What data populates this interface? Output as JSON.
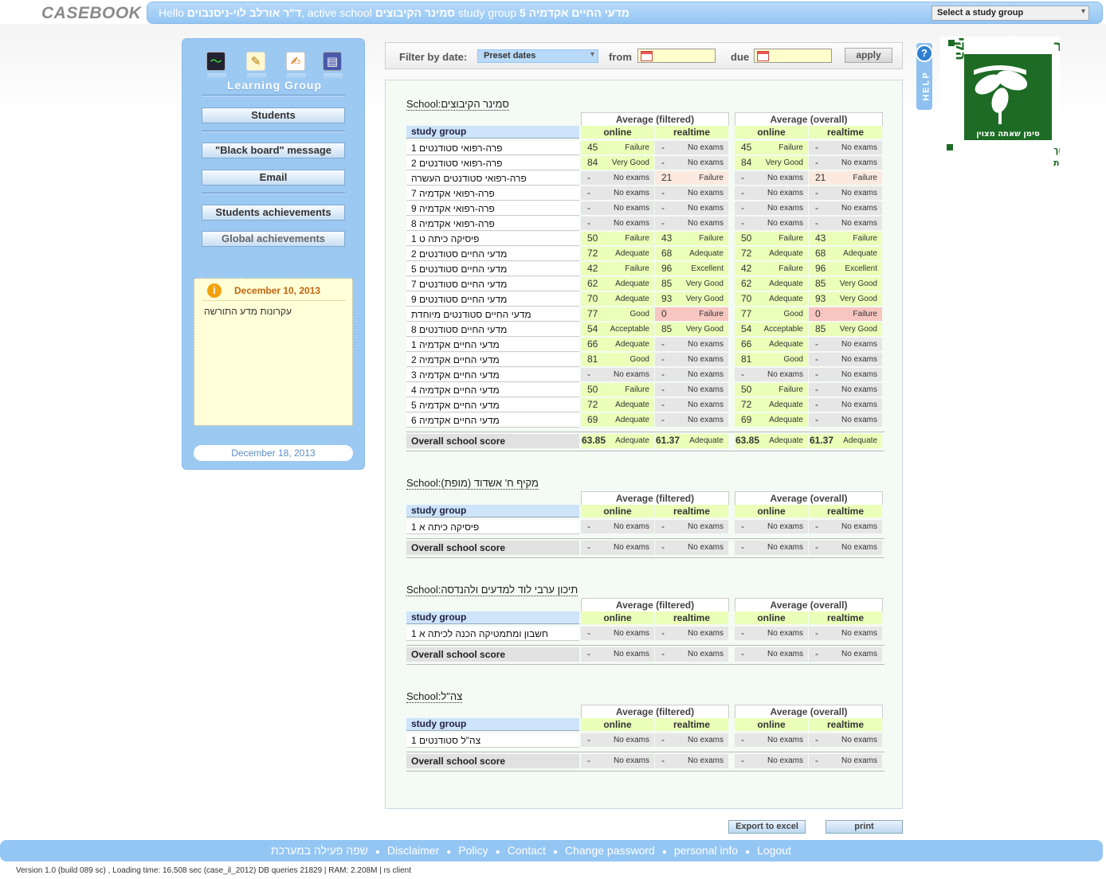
{
  "header": {
    "logo": "CASEBOOK",
    "hello_prefix": "Hello",
    "user": "ד\"ר אורלב לוי-ניסנבוים",
    "active_school_label": ", active school",
    "active_school": "סמינר הקיבוצים",
    "study_group_label": "study group",
    "study_group": "מדעי החיים אקדמיה 5",
    "select_placeholder": "Select a study group"
  },
  "sidebar": {
    "section_label": "Learning Group",
    "icons": [
      "activity-icon",
      "edit-icon",
      "notes-icon",
      "book-icon"
    ],
    "buttons": [
      "Students",
      "\"Black board\" message",
      "Email",
      "Students achievements",
      "Global achievements"
    ],
    "note": {
      "date": "December 10, 2013",
      "text": "עקרונות מדע התורשה"
    },
    "bottom_date": "December 18, 2013"
  },
  "filter": {
    "label": "Filter by date:",
    "preset": "Preset dates",
    "from_label": "from",
    "due_label": "due",
    "from_value": "",
    "due_value": "",
    "apply_label": "apply"
  },
  "help": {
    "label": "HELP",
    "icon": "question-icon"
  },
  "table_labels": {
    "school_prefix": "School:",
    "avg_filtered": "Average (filtered)",
    "avg_overall": "Average (overall)",
    "study_group": "study group",
    "online": "online",
    "realtime": "realtime",
    "overall_score": "Overall school score",
    "no_exams": "No exams",
    "dash": "-"
  },
  "schools": [
    {
      "name": "סמינר הקיבוצים",
      "groups": [
        {
          "name": "פרה-רפואי סטודנטים 1",
          "cells": [
            [
              "45",
              "Failure",
              "g"
            ],
            [
              "-",
              "No exams",
              "x"
            ],
            [
              "45",
              "Failure",
              "g"
            ],
            [
              "-",
              "No exams",
              "x"
            ]
          ]
        },
        {
          "name": "פרה-רפואי סטודנטים 2",
          "cells": [
            [
              "84",
              "Very Good",
              "g"
            ],
            [
              "-",
              "No exams",
              "x"
            ],
            [
              "84",
              "Very Good",
              "g"
            ],
            [
              "-",
              "No exams",
              "x"
            ]
          ]
        },
        {
          "name": "פרה-רפואי סטודנטים העשרה",
          "cells": [
            [
              "-",
              "No exams",
              "x"
            ],
            [
              "21",
              "Failure",
              "f"
            ],
            [
              "-",
              "No exams",
              "x"
            ],
            [
              "21",
              "Failure",
              "f"
            ]
          ]
        },
        {
          "name": "פרה-רפואי אקדמיה 7",
          "cells": [
            [
              "-",
              "No exams",
              "x"
            ],
            [
              "-",
              "No exams",
              "x"
            ],
            [
              "-",
              "No exams",
              "x"
            ],
            [
              "-",
              "No exams",
              "x"
            ]
          ]
        },
        {
          "name": "פרה-רפואי אקדמיה 9",
          "cells": [
            [
              "-",
              "No exams",
              "x"
            ],
            [
              "-",
              "No exams",
              "x"
            ],
            [
              "-",
              "No exams",
              "x"
            ],
            [
              "-",
              "No exams",
              "x"
            ]
          ]
        },
        {
          "name": "פרה-רפואי אקדמיה 8",
          "cells": [
            [
              "-",
              "No exams",
              "x"
            ],
            [
              "-",
              "No exams",
              "x"
            ],
            [
              "-",
              "No exams",
              "x"
            ],
            [
              "-",
              "No exams",
              "x"
            ]
          ]
        },
        {
          "name": "פיסיקה כיתה ט 1",
          "cells": [
            [
              "50",
              "Failure",
              "g"
            ],
            [
              "43",
              "Failure",
              "g"
            ],
            [
              "50",
              "Failure",
              "g"
            ],
            [
              "43",
              "Failure",
              "g"
            ]
          ]
        },
        {
          "name": "מדעי החיים סטודנטים 2",
          "cells": [
            [
              "72",
              "Adequate",
              "g"
            ],
            [
              "68",
              "Adequate",
              "g"
            ],
            [
              "72",
              "Adequate",
              "g"
            ],
            [
              "68",
              "Adequate",
              "g"
            ]
          ]
        },
        {
          "name": "מדעי החיים סטודנטים 5",
          "cells": [
            [
              "42",
              "Failure",
              "g"
            ],
            [
              "96",
              "Excellent",
              "g"
            ],
            [
              "42",
              "Failure",
              "g"
            ],
            [
              "96",
              "Excellent",
              "g"
            ]
          ]
        },
        {
          "name": "מדעי החיים סטודנטים 7",
          "cells": [
            [
              "62",
              "Adequate",
              "g"
            ],
            [
              "85",
              "Very Good",
              "g"
            ],
            [
              "62",
              "Adequate",
              "g"
            ],
            [
              "85",
              "Very Good",
              "g"
            ]
          ]
        },
        {
          "name": "מדעי החיים סטודנטים 9",
          "cells": [
            [
              "70",
              "Adequate",
              "g"
            ],
            [
              "93",
              "Very Good",
              "g"
            ],
            [
              "70",
              "Adequate",
              "g"
            ],
            [
              "93",
              "Very Good",
              "g"
            ]
          ]
        },
        {
          "name": "מדעי החיים סטודנטים מיוחדת",
          "cells": [
            [
              "77",
              "Good",
              "g"
            ],
            [
              "0",
              "Failure",
              "r"
            ],
            [
              "77",
              "Good",
              "g"
            ],
            [
              "0",
              "Failure",
              "r"
            ]
          ]
        },
        {
          "name": "מדעי החיים סטודנטים 8",
          "cells": [
            [
              "54",
              "Acceptable",
              "g"
            ],
            [
              "85",
              "Very Good",
              "g"
            ],
            [
              "54",
              "Acceptable",
              "g"
            ],
            [
              "85",
              "Very Good",
              "g"
            ]
          ]
        },
        {
          "name": "מדעי החיים אקדמיה 1",
          "cells": [
            [
              "66",
              "Adequate",
              "g"
            ],
            [
              "-",
              "No exams",
              "x"
            ],
            [
              "66",
              "Adequate",
              "g"
            ],
            [
              "-",
              "No exams",
              "x"
            ]
          ]
        },
        {
          "name": "מדעי החיים אקדמיה 2",
          "cells": [
            [
              "81",
              "Good",
              "g"
            ],
            [
              "-",
              "No exams",
              "x"
            ],
            [
              "81",
              "Good",
              "g"
            ],
            [
              "-",
              "No exams",
              "x"
            ]
          ]
        },
        {
          "name": "מדעי החיים אקדמיה 3",
          "cells": [
            [
              "-",
              "No exams",
              "x"
            ],
            [
              "-",
              "No exams",
              "x"
            ],
            [
              "-",
              "No exams",
              "x"
            ],
            [
              "-",
              "No exams",
              "x"
            ]
          ]
        },
        {
          "name": "מדעי החיים אקדמיה 4",
          "cells": [
            [
              "50",
              "Failure",
              "g"
            ],
            [
              "-",
              "No exams",
              "x"
            ],
            [
              "50",
              "Failure",
              "g"
            ],
            [
              "-",
              "No exams",
              "x"
            ]
          ]
        },
        {
          "name": "מדעי החיים אקדמיה 5",
          "cells": [
            [
              "72",
              "Adequate",
              "g"
            ],
            [
              "-",
              "No exams",
              "x"
            ],
            [
              "72",
              "Adequate",
              "g"
            ],
            [
              "-",
              "No exams",
              "x"
            ]
          ]
        },
        {
          "name": "מדעי החיים אקדמיה 6",
          "cells": [
            [
              "69",
              "Adequate",
              "g"
            ],
            [
              "-",
              "No exams",
              "x"
            ],
            [
              "69",
              "Adequate",
              "g"
            ],
            [
              "-",
              "No exams",
              "x"
            ]
          ]
        }
      ],
      "overall": [
        [
          "63.85",
          "Adequate",
          "g"
        ],
        [
          "61.37",
          "Adequate",
          "g"
        ],
        [
          "63.85",
          "Adequate",
          "g"
        ],
        [
          "61.37",
          "Adequate",
          "g"
        ]
      ]
    },
    {
      "name": "מקיף ח' אשדוד (מופת)",
      "groups": [
        {
          "name": "פיסיקה כיתה א 1",
          "cells": [
            [
              "-",
              "No exams",
              "x"
            ],
            [
              "-",
              "No exams",
              "x"
            ],
            [
              "-",
              "No exams",
              "x"
            ],
            [
              "-",
              "No exams",
              "x"
            ]
          ]
        }
      ],
      "overall": [
        [
          "-",
          "No exams",
          "x"
        ],
        [
          "-",
          "No exams",
          "x"
        ],
        [
          "-",
          "No exams",
          "x"
        ],
        [
          "-",
          "No exams",
          "x"
        ]
      ]
    },
    {
      "name": "תיכון ערבי לוד למדעים ולהנדסה",
      "groups": [
        {
          "name": "חשבון ומתמטיקה הכנה לכיתה א 1",
          "cells": [
            [
              "-",
              "No exams",
              "x"
            ],
            [
              "-",
              "No exams",
              "x"
            ],
            [
              "-",
              "No exams",
              "x"
            ],
            [
              "-",
              "No exams",
              "x"
            ]
          ]
        }
      ],
      "overall": [
        [
          "-",
          "No exams",
          "x"
        ],
        [
          "-",
          "No exams",
          "x"
        ],
        [
          "-",
          "No exams",
          "x"
        ],
        [
          "-",
          "No exams",
          "x"
        ]
      ]
    },
    {
      "name": "צה\"ל",
      "groups": [
        {
          "name": "צה\"ל סטודנטים 1",
          "cells": [
            [
              "-",
              "No exams",
              "x"
            ],
            [
              "-",
              "No exams",
              "x"
            ],
            [
              "-",
              "No exams",
              "x"
            ],
            [
              "-",
              "No exams",
              "x"
            ]
          ]
        }
      ],
      "overall": [
        [
          "-",
          "No exams",
          "x"
        ],
        [
          "-",
          "No exams",
          "x"
        ],
        [
          "-",
          "No exams",
          "x"
        ],
        [
          "-",
          "No exams",
          "x"
        ]
      ]
    }
  ],
  "actions": {
    "export": "Export to excel",
    "print": "print"
  },
  "footer": {
    "links": [
      "שפה פעילה במערכת",
      "Disclaimer",
      "Policy",
      "Contact",
      "Change password",
      "personal info",
      "Logout"
    ],
    "version": "Version 1.0 (build 089 sc) , Loading time: 16.508 sec  (case_il_2012) DB queries 21829 | RAM: 2.208M | rs client"
  },
  "school_logo": {
    "title": "סמינר הקיבוצים",
    "motto": "סימן שאתה מצוין",
    "subtitle_1": "המכללה לחינוך",
    "subtitle_2": "לטכנולוגיה ולאמנויות",
    "brand_color": "#1d6b24"
  },
  "colors": {
    "accent": "#94c6f4",
    "pass_bg": "#eaffb8",
    "no_exam_bg": "#e6e6e6",
    "fail_bg": "#fbe9e0",
    "zero_bg": "#f8c6c0"
  }
}
